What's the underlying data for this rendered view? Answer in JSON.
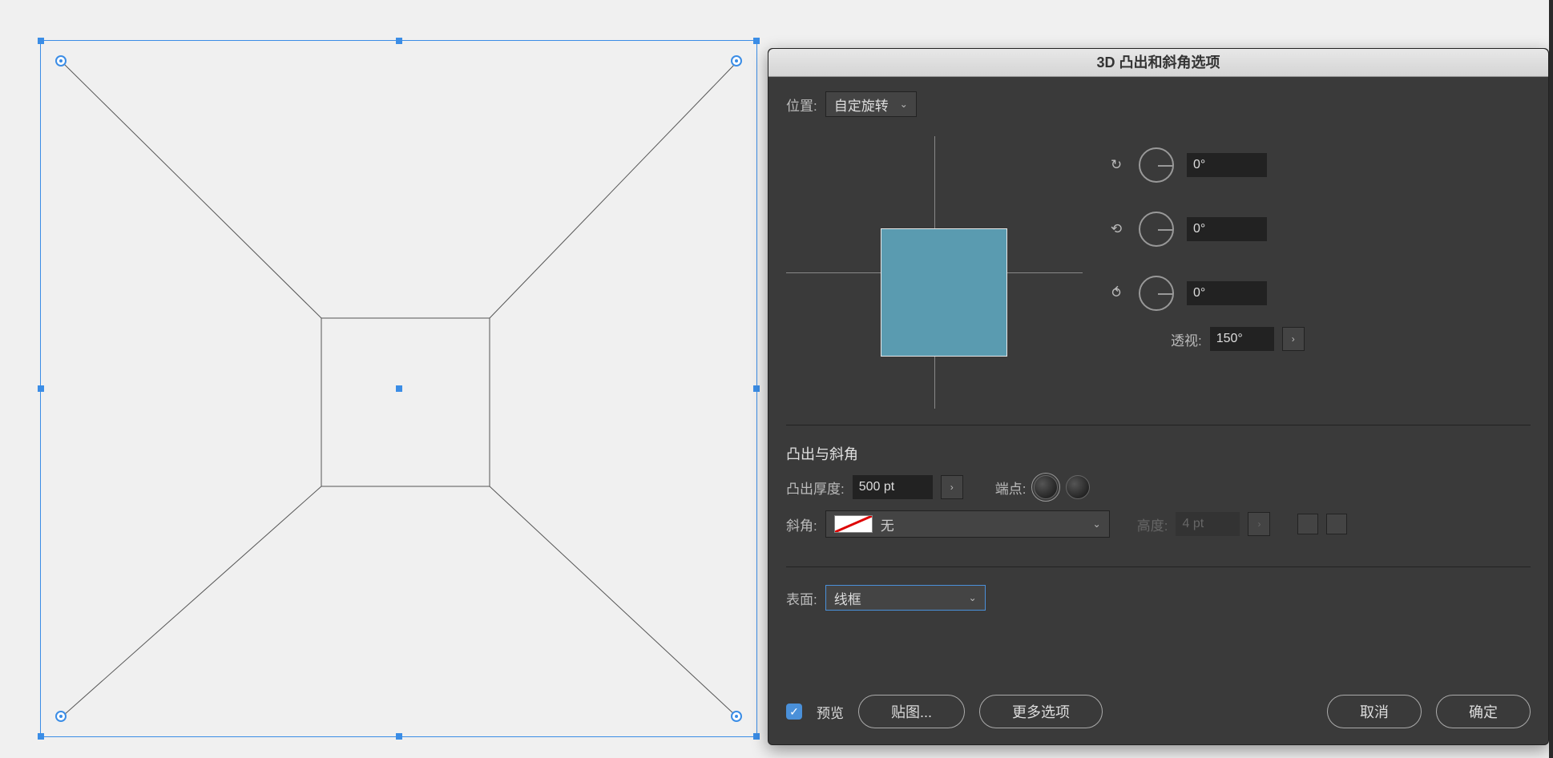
{
  "dialog": {
    "title": "3D 凸出和斜角选项",
    "position_label": "位置:",
    "position_value": "自定旋转",
    "rotation": {
      "x": "0°",
      "y": "0°",
      "z": "0°"
    },
    "perspective_label": "透视:",
    "perspective_value": "150°",
    "extrude_section_title": "凸出与斜角",
    "extrude_depth_label": "凸出厚度:",
    "extrude_depth_value": "500 pt",
    "cap_label": "端点:",
    "bevel_label": "斜角:",
    "bevel_value": "无",
    "height_label": "高度:",
    "height_value": "4 pt",
    "surface_label": "表面:",
    "surface_value": "线框",
    "preview_label": "预览",
    "map_art_label": "贴图...",
    "more_options_label": "更多选项",
    "cancel_label": "取消",
    "ok_label": "确定"
  }
}
